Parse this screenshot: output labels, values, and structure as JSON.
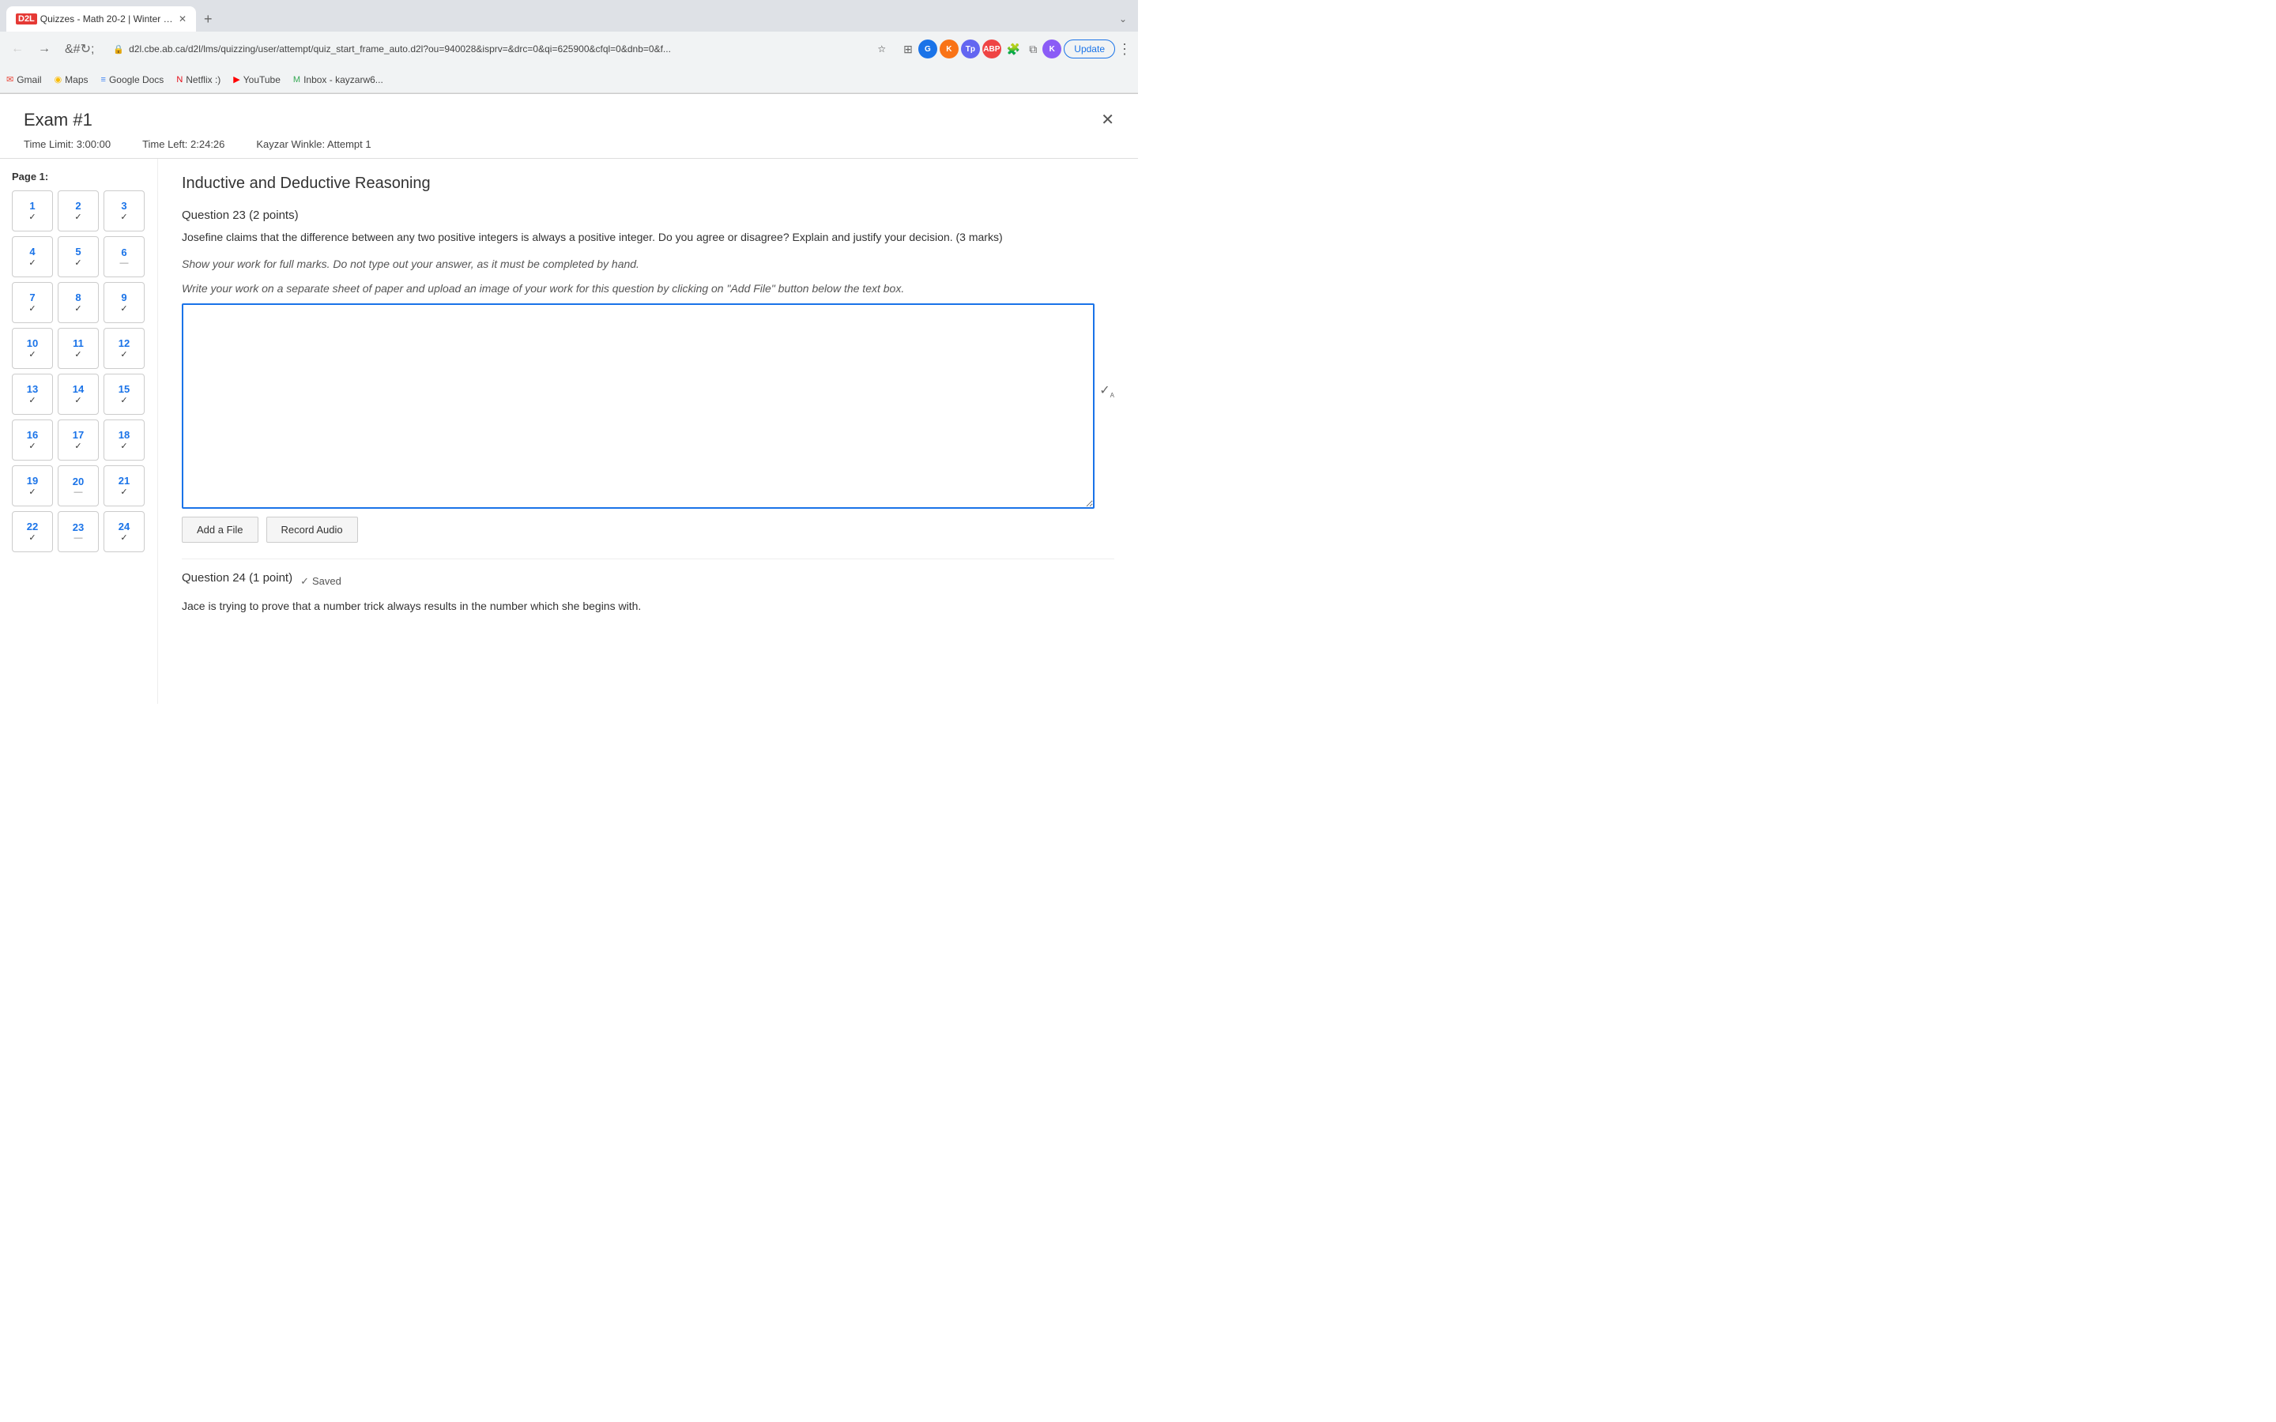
{
  "browser": {
    "tab": {
      "title": "Quizzes - Math 20-2 | Winter 2...",
      "favicon": "M"
    },
    "url": "d2l.cbe.ab.ca/d2l/lms/quizzing/user/attempt/quiz_start_frame_auto.d2l?ou=940028&isprv=&drc=0&qi=625900&cfql=0&dnb=0&f...",
    "update_label": "Update"
  },
  "bookmarks": [
    {
      "id": "gmail",
      "label": "Gmail",
      "icon": "✉"
    },
    {
      "id": "maps",
      "label": "Maps",
      "icon": "◉"
    },
    {
      "id": "docs",
      "label": "Google Docs",
      "icon": "≡"
    },
    {
      "id": "netflix",
      "label": "Netflix :)",
      "icon": "N"
    },
    {
      "id": "youtube",
      "label": "YouTube",
      "icon": "▶"
    },
    {
      "id": "inbox",
      "label": "Inbox - kayzarw6...",
      "icon": "M"
    }
  ],
  "exam": {
    "title": "Exam #1",
    "time_limit_label": "Time Limit: 3:00:00",
    "time_left_label": "Time Left:",
    "time_left_value": "2:24:26",
    "attempt_label": "Kayzar Winkle: Attempt 1"
  },
  "sidebar": {
    "page_label": "Page 1:",
    "questions": [
      {
        "num": "1",
        "status": "✓"
      },
      {
        "num": "2",
        "status": "✓"
      },
      {
        "num": "3",
        "status": "✓"
      },
      {
        "num": "4",
        "status": "✓"
      },
      {
        "num": "5",
        "status": "✓"
      },
      {
        "num": "6",
        "status": "—"
      },
      {
        "num": "7",
        "status": "✓"
      },
      {
        "num": "8",
        "status": "✓"
      },
      {
        "num": "9",
        "status": "✓"
      },
      {
        "num": "10",
        "status": "✓"
      },
      {
        "num": "11",
        "status": "✓"
      },
      {
        "num": "12",
        "status": "✓"
      },
      {
        "num": "13",
        "status": "✓"
      },
      {
        "num": "14",
        "status": "✓"
      },
      {
        "num": "15",
        "status": "✓"
      },
      {
        "num": "16",
        "status": "✓"
      },
      {
        "num": "17",
        "status": "✓"
      },
      {
        "num": "18",
        "status": "✓"
      },
      {
        "num": "19",
        "status": "✓"
      },
      {
        "num": "20",
        "status": "—"
      },
      {
        "num": "21",
        "status": "✓"
      },
      {
        "num": "22",
        "status": "✓"
      },
      {
        "num": "23",
        "status": "—"
      },
      {
        "num": "24",
        "status": "✓"
      }
    ]
  },
  "content": {
    "section_title": "Inductive and Deductive Reasoning",
    "question23": {
      "label": "Question 23",
      "points": "(2 points)",
      "text": "Josefine claims that the difference between any two positive integers is always a positive integer. Do you agree or disagree?  Explain and justify your decision.  (3 marks)",
      "instruction1": "Show your work for full marks.  Do not type out your answer, as it must be completed by hand.",
      "instruction2": "Write your work on a separate sheet of paper and upload an image of your work for this question by clicking on \"Add File\" button below the text box.",
      "answer_placeholder": "",
      "add_file_label": "Add a File",
      "record_audio_label": "Record Audio"
    },
    "question24": {
      "label": "Question 24",
      "points": "(1 point)",
      "saved_label": "Saved",
      "text": "Jace is trying to prove that a number trick always results in the number which she begins with."
    }
  }
}
